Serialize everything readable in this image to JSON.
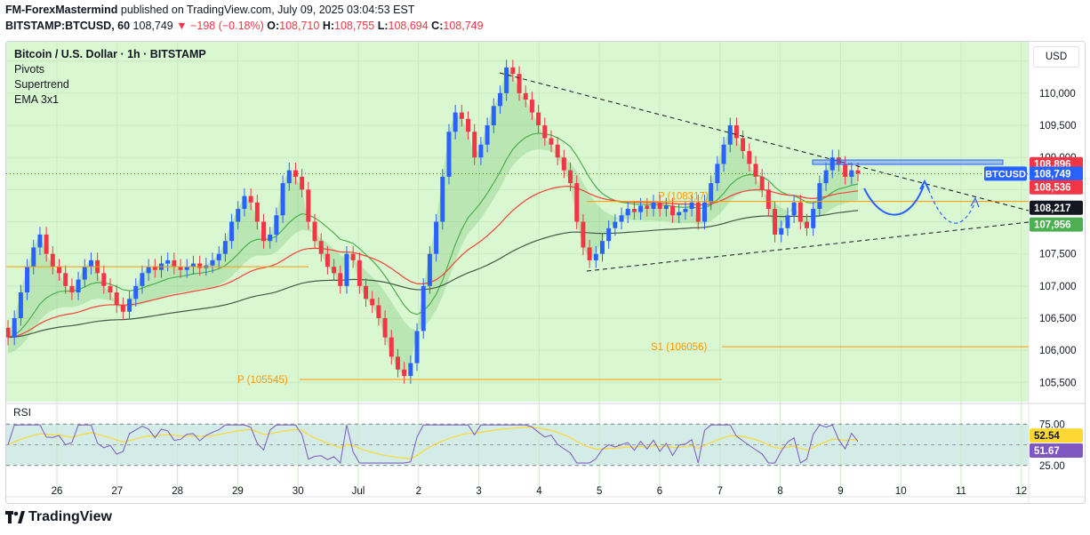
{
  "header": {
    "author": "FM-ForexMastermind",
    "published": "published on TradingView.com, July 09, 2025 03:04:53 EST",
    "symbol": "BITSTAMP:BTCUSD, 60",
    "last": "108,749",
    "change": "▼ −198 (−0.18%)",
    "o_label": "O:",
    "o": "108,710",
    "h_label": "H:",
    "h": "108,755",
    "l_label": "L:",
    "l": "108,694",
    "c_label": "C:",
    "c": "108,749"
  },
  "legend": {
    "title": "Bitcoin / U.S. Dollar · 1h · BITSTAMP",
    "items": [
      "Pivots",
      "Supertrend",
      "EMA 3x1"
    ]
  },
  "currency_button": "USD",
  "rsi_label": "RSI",
  "footer": {
    "brand": "TradingView"
  },
  "colors": {
    "up": "#2962ff",
    "down": "#f23645",
    "bg_green": "#d9f7d0",
    "rsi_bg": "#d3ece7",
    "ema_fast": "#4caf50",
    "ema_mid": "#f44336",
    "ema_slow": "#455a45",
    "pivot": "#ff9800",
    "rsi": "#7e57c2",
    "rsi_ma": "#fdd835"
  },
  "chart_data": {
    "type": "candlestick",
    "symbol_tag": "BTCUSD",
    "x_ticks": [
      "26",
      "27",
      "28",
      "29",
      "30",
      "Jul",
      "2",
      "3",
      "4",
      "5",
      "6",
      "7",
      "8",
      "9",
      "10",
      "11",
      "12"
    ],
    "y_ticks": [
      105500,
      106000,
      106500,
      107000,
      107500,
      108000,
      108500,
      109000,
      109500,
      110000,
      110500
    ],
    "y_tick_labels": [
      "105,500",
      "106,000",
      "106,500",
      "107,000",
      "107,500",
      "108,000",
      "108,500",
      "109,000",
      "109,500",
      "110,000",
      "110,500"
    ],
    "ylim": [
      105200,
      110800
    ],
    "xlim_days": [
      25.3,
      37.5
    ],
    "price_tags": [
      {
        "label": "108,896",
        "value": 108896,
        "color": "#f23645"
      },
      {
        "label": "108,749",
        "value": 108749,
        "color": "#2962ff"
      },
      {
        "label": "108,536",
        "value": 108536,
        "color": "#f23645"
      },
      {
        "label": "108,217",
        "value": 108217,
        "color": "#131722"
      },
      {
        "label": "107,956",
        "value": 107956,
        "color": "#4caf50"
      }
    ],
    "pivots": [
      {
        "label": "P (105545)",
        "value": 105545
      },
      {
        "label": "P (108317)",
        "value": 108317
      },
      {
        "label": "S1 (106056)",
        "value": 106056
      }
    ],
    "rsi": {
      "ticks": [
        75,
        50,
        25
      ],
      "tick_labels": [
        "75.00",
        "",
        "25.00"
      ],
      "tags": [
        {
          "label": "52.54",
          "value": 52.54,
          "color": "#fdd835"
        },
        {
          "label": "51.67",
          "value": 51.67,
          "color": "#7e57c2"
        }
      ]
    },
    "closes": [
      106200,
      106500,
      106900,
      107300,
      107600,
      107800,
      107500,
      107300,
      107200,
      107000,
      106900,
      107100,
      107300,
      107400,
      107200,
      107000,
      106900,
      106700,
      106600,
      106800,
      107000,
      107200,
      107300,
      107250,
      107350,
      107400,
      107300,
      107250,
      107300,
      107350,
      107280,
      107320,
      107400,
      107500,
      107700,
      108000,
      108200,
      108400,
      108300,
      108000,
      107700,
      107800,
      108100,
      108600,
      108800,
      108700,
      108500,
      108000,
      107700,
      107500,
      107300,
      107200,
      107000,
      107500,
      107400,
      107000,
      106800,
      106700,
      106500,
      106200,
      105900,
      105700,
      105600,
      105800,
      106300,
      107000,
      107500,
      108000,
      108700,
      109400,
      109700,
      109600,
      109400,
      109000,
      109200,
      109500,
      109800,
      110000,
      110400,
      110300,
      110000,
      109900,
      109700,
      109500,
      109300,
      109200,
      109000,
      108800,
      108600,
      108000,
      107600,
      107400,
      107500,
      107700,
      107900,
      108000,
      108100,
      108200,
      108150,
      108250,
      108200,
      108300,
      108200,
      108250,
      108100,
      108150,
      108200,
      108300,
      108000,
      108300,
      108600,
      108900,
      109200,
      109500,
      109300,
      109100,
      108900,
      108700,
      108500,
      108200,
      107800,
      107900,
      108100,
      108300,
      108000,
      107900,
      108200,
      108600,
      108800,
      109000,
      108900,
      108700,
      108800,
      108750
    ]
  }
}
